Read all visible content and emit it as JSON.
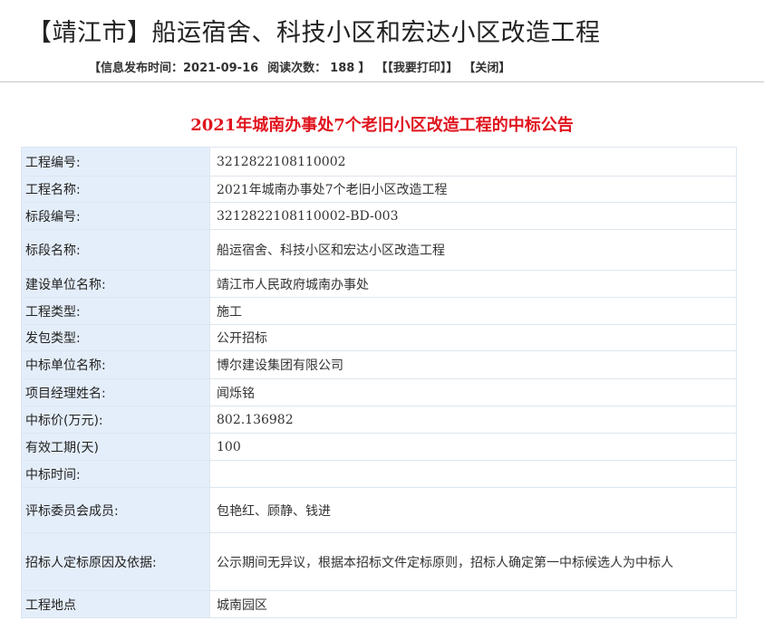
{
  "header": {
    "title": "【靖江市】船运宿舍、科技小区和宏达小区改造工程",
    "publish_label": "【信息发布时间：2021-09-16",
    "read_label": "阅读次数：",
    "read_count": "188",
    "read_close": "】",
    "print_label": "【【我要打印】】",
    "close_label": "【关闭】"
  },
  "notice": {
    "title": "2021年城南办事处7个老旧小区改造工程的中标公告"
  },
  "rows": [
    {
      "label": "工程编号:",
      "value": "3212822108110002"
    },
    {
      "label": "工程名称:",
      "value": "2021年城南办事处7个老旧小区改造工程"
    },
    {
      "label": "标段编号:",
      "value": "3212822108110002-BD-003"
    },
    {
      "label": "标段名称:",
      "value": "船运宿舍、科技小区和宏达小区改造工程"
    },
    {
      "label": "建设单位名称:",
      "value": "靖江市人民政府城南办事处"
    },
    {
      "label": "工程类型:",
      "value": "施工"
    },
    {
      "label": "发包类型:",
      "value": "公开招标"
    },
    {
      "label": "中标单位名称:",
      "value": "博尔建设集团有限公司"
    },
    {
      "label": "项目经理姓名:",
      "value": "闻烁铭"
    },
    {
      "label": "中标价(万元):",
      "value": "802.136982"
    },
    {
      "label": "有效工期(天)",
      "value": "100"
    },
    {
      "label": "中标时间:",
      "value": ""
    },
    {
      "label": "评标委员会成员:",
      "value": "包艳红、顾静、钱进"
    },
    {
      "label": "招标人定标原因及依据:",
      "value": "公示期间无异议，根据本招标文件定标原则，招标人确定第一中标候选人为中标人"
    },
    {
      "label": "工程地点",
      "value": "城南园区"
    }
  ]
}
